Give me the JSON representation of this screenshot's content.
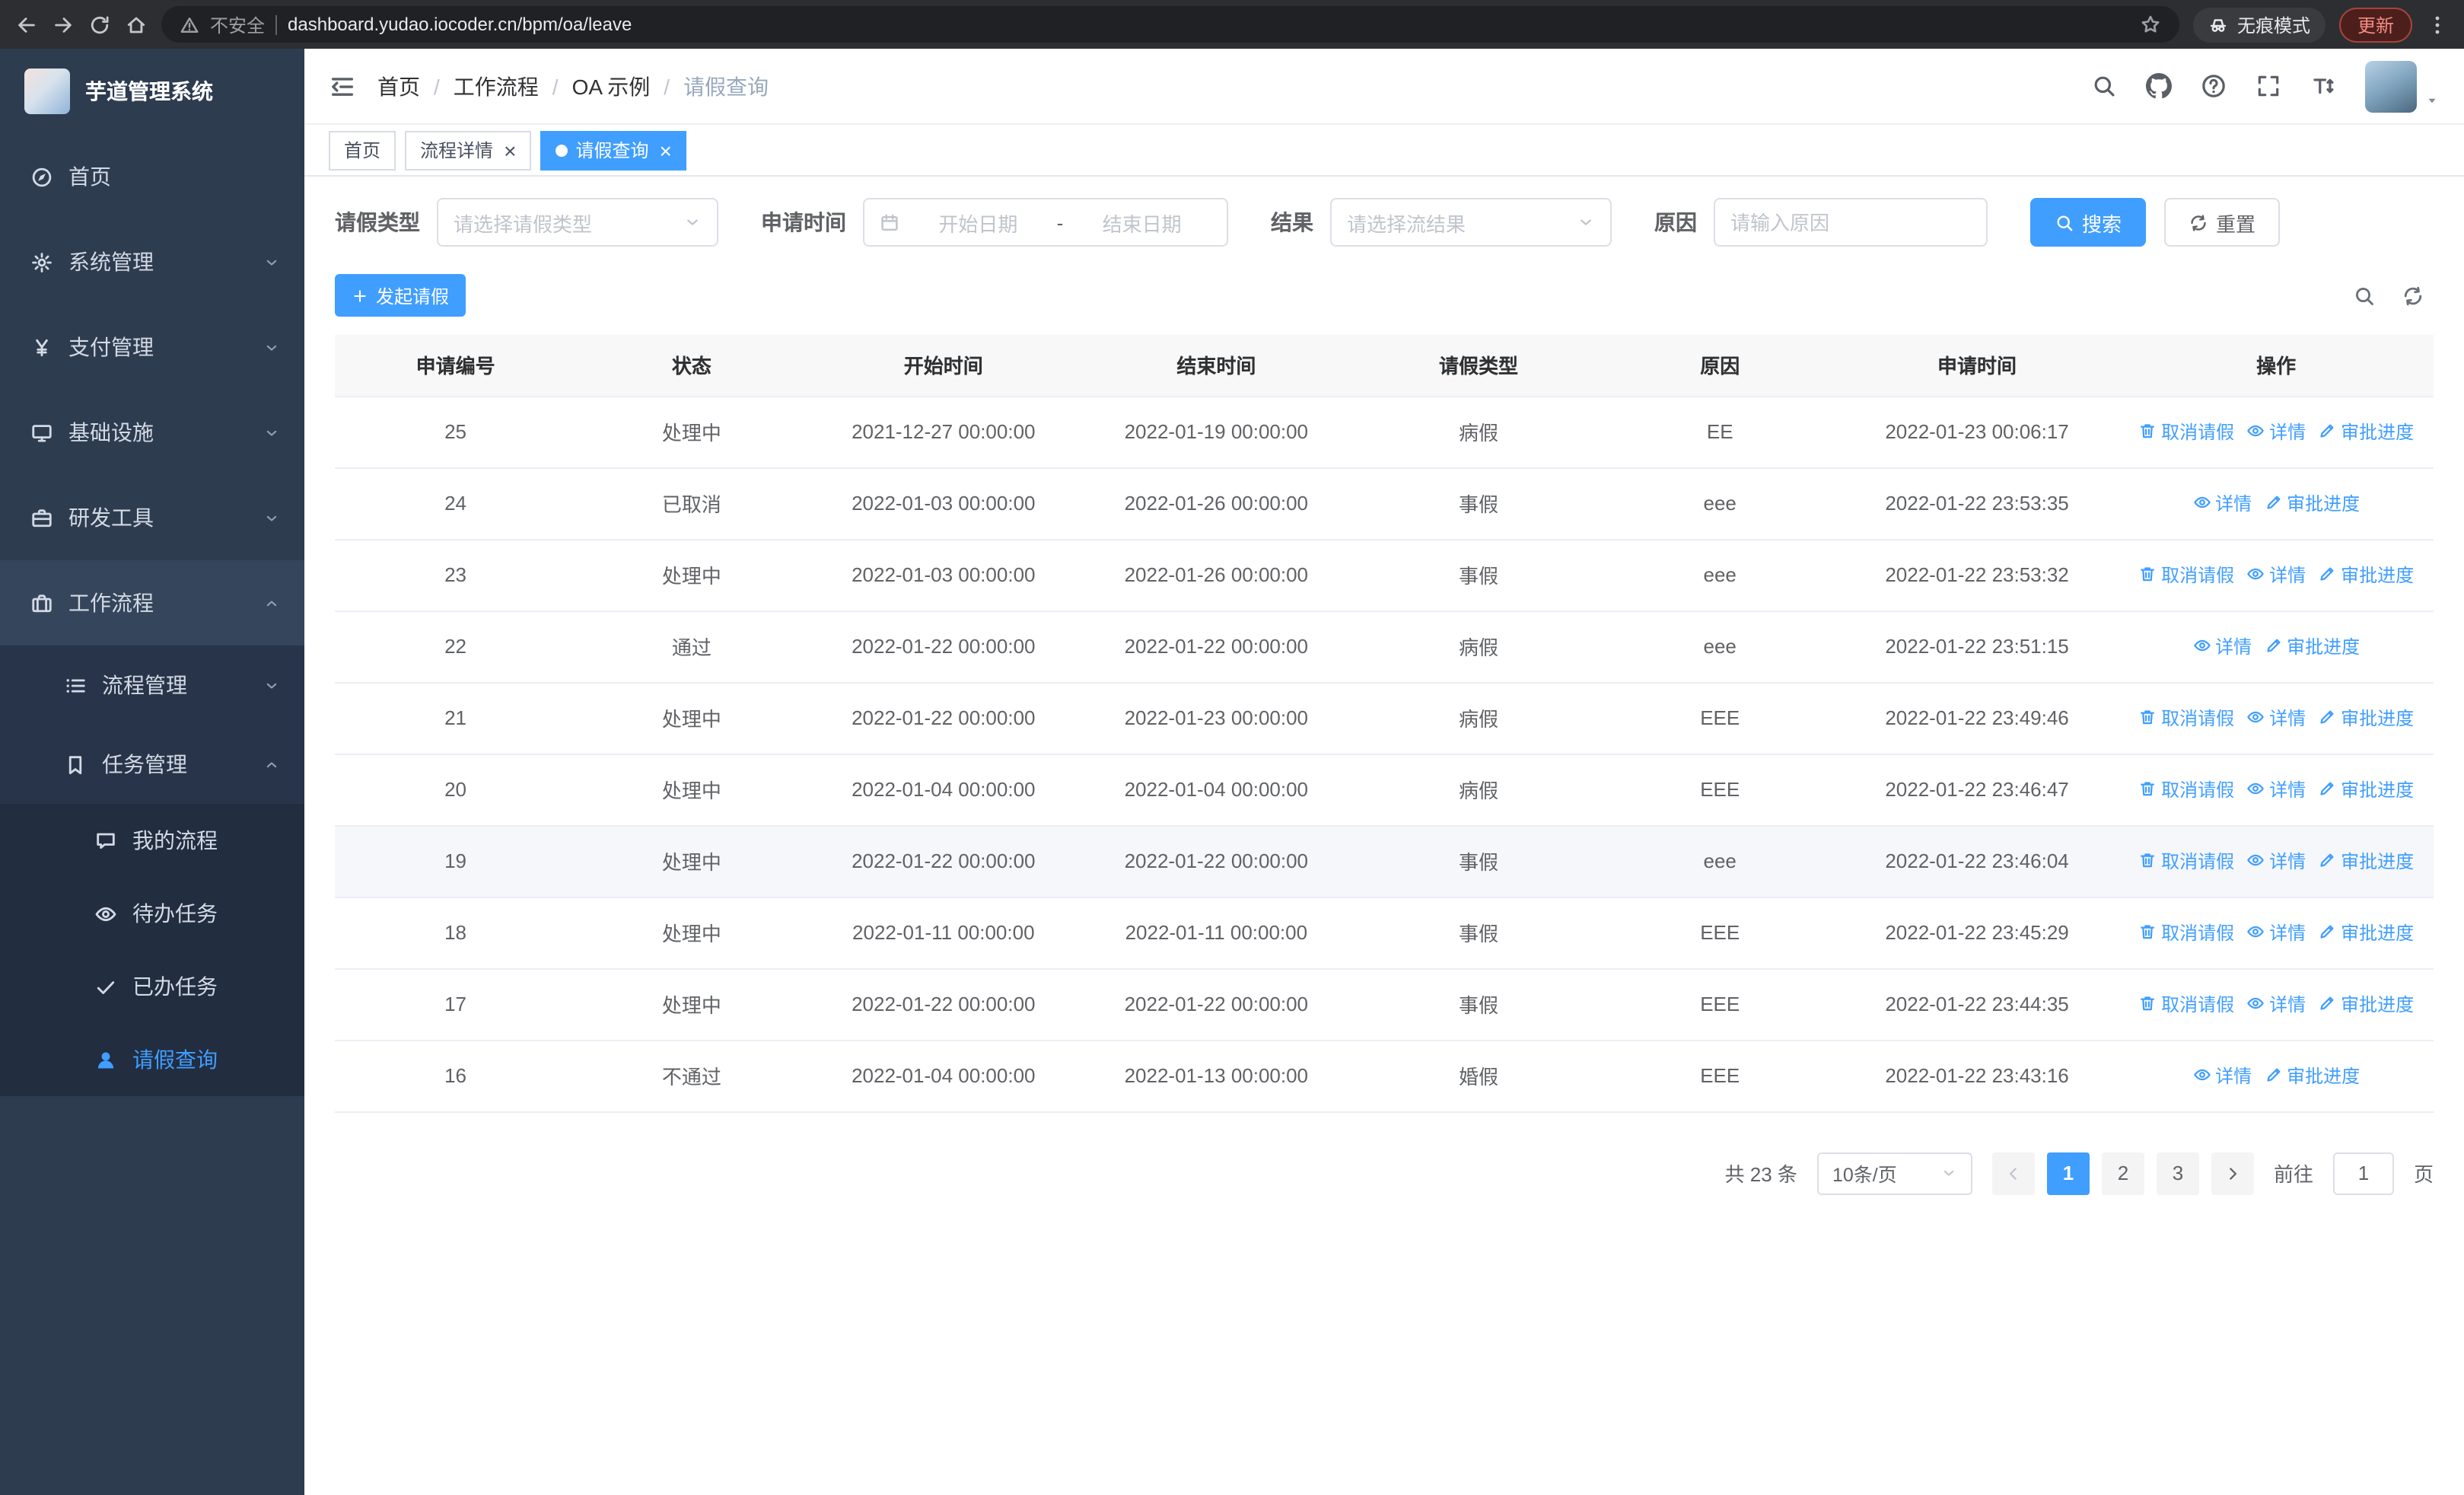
{
  "browser": {
    "security_label": "不安全",
    "url": "dashboard.yudao.iocoder.cn/bpm/oa/leave",
    "incognito_label": "无痕模式",
    "update_label": "更新"
  },
  "sidebar": {
    "app_title": "芋道管理系统",
    "menu": [
      {
        "name": "home",
        "label": "首页",
        "icon": "compass-icon",
        "level": 1
      },
      {
        "name": "system-management",
        "label": "系统管理",
        "icon": "gear-icon",
        "level": 1,
        "arrow": "down"
      },
      {
        "name": "payment-management",
        "label": "支付管理",
        "icon": "yen-icon",
        "level": 1,
        "arrow": "down"
      },
      {
        "name": "infrastructure",
        "label": "基础设施",
        "icon": "monitor-icon",
        "level": 1,
        "arrow": "down"
      },
      {
        "name": "dev-tools",
        "label": "研发工具",
        "icon": "briefcase-icon",
        "level": 1,
        "arrow": "down"
      },
      {
        "name": "workflow",
        "label": "工作流程",
        "icon": "suitcase-icon",
        "level": 1,
        "arrow": "up",
        "open": true
      },
      {
        "name": "process-management",
        "label": "流程管理",
        "icon": "list-icon",
        "level": 2,
        "arrow": "down"
      },
      {
        "name": "task-management",
        "label": "任务管理",
        "icon": "bookmark-icon",
        "level": 2,
        "arrow": "up",
        "open": true
      },
      {
        "name": "my-process",
        "label": "我的流程",
        "icon": "chat-icon",
        "level": 3
      },
      {
        "name": "todo-tasks",
        "label": "待办任务",
        "icon": "eye-icon",
        "level": 3
      },
      {
        "name": "done-tasks",
        "label": "已办任务",
        "icon": "check-icon",
        "level": 3
      },
      {
        "name": "leave-query",
        "label": "请假查询",
        "icon": "user-icon",
        "level": 3,
        "active": true
      }
    ]
  },
  "header": {
    "breadcrumb": [
      "首页",
      "工作流程",
      "OA 示例",
      "请假查询"
    ]
  },
  "tabs": [
    {
      "name": "home",
      "label": "首页",
      "closable": false,
      "active": false
    },
    {
      "name": "process-detail",
      "label": "流程详情",
      "closable": true,
      "active": false
    },
    {
      "name": "leave-query",
      "label": "请假查询",
      "closable": true,
      "active": true
    }
  ],
  "filters": {
    "leave_type_label": "请假类型",
    "leave_type_placeholder": "请选择请假类型",
    "apply_time_label": "申请时间",
    "start_date_placeholder": "开始日期",
    "range_separator": "-",
    "end_date_placeholder": "结束日期",
    "result_label": "结果",
    "result_placeholder": "请选择流结果",
    "reason_label": "原因",
    "reason_placeholder": "请输入原因",
    "search_label": "搜索",
    "reset_label": "重置"
  },
  "toolbar": {
    "create_label": "发起请假"
  },
  "table": {
    "headers": [
      "申请编号",
      "状态",
      "开始时间",
      "结束时间",
      "请假类型",
      "原因",
      "申请时间",
      "操作"
    ],
    "rows": [
      {
        "id": "25",
        "status": "处理中",
        "start_time": "2021-12-27 00:00:00",
        "end_time": "2022-01-19 00:00:00",
        "leave_type": "病假",
        "reason": "EE",
        "apply_time": "2022-01-23 00:06:17",
        "highlighted": false,
        "actions": [
          {
            "label": "取消请假",
            "icon": "trash-icon"
          },
          {
            "label": "详情",
            "icon": "eye-icon"
          },
          {
            "label": "审批进度",
            "icon": "edit-icon"
          }
        ]
      },
      {
        "id": "24",
        "status": "已取消",
        "start_time": "2022-01-03 00:00:00",
        "end_time": "2022-01-26 00:00:00",
        "leave_type": "事假",
        "reason": "eee",
        "apply_time": "2022-01-22 23:53:35",
        "highlighted": false,
        "actions": [
          {
            "label": "详情",
            "icon": "eye-icon"
          },
          {
            "label": "审批进度",
            "icon": "edit-icon"
          }
        ]
      },
      {
        "id": "23",
        "status": "处理中",
        "start_time": "2022-01-03 00:00:00",
        "end_time": "2022-01-26 00:00:00",
        "leave_type": "事假",
        "reason": "eee",
        "apply_time": "2022-01-22 23:53:32",
        "highlighted": false,
        "actions": [
          {
            "label": "取消请假",
            "icon": "trash-icon"
          },
          {
            "label": "详情",
            "icon": "eye-icon"
          },
          {
            "label": "审批进度",
            "icon": "edit-icon"
          }
        ]
      },
      {
        "id": "22",
        "status": "通过",
        "start_time": "2022-01-22 00:00:00",
        "end_time": "2022-01-22 00:00:00",
        "leave_type": "病假",
        "reason": "eee",
        "apply_time": "2022-01-22 23:51:15",
        "highlighted": false,
        "actions": [
          {
            "label": "详情",
            "icon": "eye-icon"
          },
          {
            "label": "审批进度",
            "icon": "edit-icon"
          }
        ]
      },
      {
        "id": "21",
        "status": "处理中",
        "start_time": "2022-01-22 00:00:00",
        "end_time": "2022-01-23 00:00:00",
        "leave_type": "病假",
        "reason": "EEE",
        "apply_time": "2022-01-22 23:49:46",
        "highlighted": false,
        "actions": [
          {
            "label": "取消请假",
            "icon": "trash-icon"
          },
          {
            "label": "详情",
            "icon": "eye-icon"
          },
          {
            "label": "审批进度",
            "icon": "edit-icon"
          }
        ]
      },
      {
        "id": "20",
        "status": "处理中",
        "start_time": "2022-01-04 00:00:00",
        "end_time": "2022-01-04 00:00:00",
        "leave_type": "病假",
        "reason": "EEE",
        "apply_time": "2022-01-22 23:46:47",
        "highlighted": false,
        "actions": [
          {
            "label": "取消请假",
            "icon": "trash-icon"
          },
          {
            "label": "详情",
            "icon": "eye-icon"
          },
          {
            "label": "审批进度",
            "icon": "edit-icon"
          }
        ]
      },
      {
        "id": "19",
        "status": "处理中",
        "start_time": "2022-01-22 00:00:00",
        "end_time": "2022-01-22 00:00:00",
        "leave_type": "事假",
        "reason": "eee",
        "apply_time": "2022-01-22 23:46:04",
        "highlighted": true,
        "actions": [
          {
            "label": "取消请假",
            "icon": "trash-icon"
          },
          {
            "label": "详情",
            "icon": "eye-icon"
          },
          {
            "label": "审批进度",
            "icon": "edit-icon"
          }
        ]
      },
      {
        "id": "18",
        "status": "处理中",
        "start_time": "2022-01-11 00:00:00",
        "end_time": "2022-01-11 00:00:00",
        "leave_type": "事假",
        "reason": "EEE",
        "apply_time": "2022-01-22 23:45:29",
        "highlighted": false,
        "actions": [
          {
            "label": "取消请假",
            "icon": "trash-icon"
          },
          {
            "label": "详情",
            "icon": "eye-icon"
          },
          {
            "label": "审批进度",
            "icon": "edit-icon"
          }
        ]
      },
      {
        "id": "17",
        "status": "处理中",
        "start_time": "2022-01-22 00:00:00",
        "end_time": "2022-01-22 00:00:00",
        "leave_type": "事假",
        "reason": "EEE",
        "apply_time": "2022-01-22 23:44:35",
        "highlighted": false,
        "actions": [
          {
            "label": "取消请假",
            "icon": "trash-icon"
          },
          {
            "label": "详情",
            "icon": "eye-icon"
          },
          {
            "label": "审批进度",
            "icon": "edit-icon"
          }
        ]
      },
      {
        "id": "16",
        "status": "不通过",
        "start_time": "2022-01-04 00:00:00",
        "end_time": "2022-01-13 00:00:00",
        "leave_type": "婚假",
        "reason": "EEE",
        "apply_time": "2022-01-22 23:43:16",
        "highlighted": false,
        "actions": [
          {
            "label": "详情",
            "icon": "eye-icon"
          },
          {
            "label": "审批进度",
            "icon": "edit-icon"
          }
        ]
      }
    ]
  },
  "pagination": {
    "total_label": "共 23 条",
    "page_size_value": "10条/页",
    "pages": [
      "1",
      "2",
      "3"
    ],
    "active_page": "1",
    "goto_label": "前往",
    "goto_value": "1",
    "goto_suffix": "页"
  }
}
